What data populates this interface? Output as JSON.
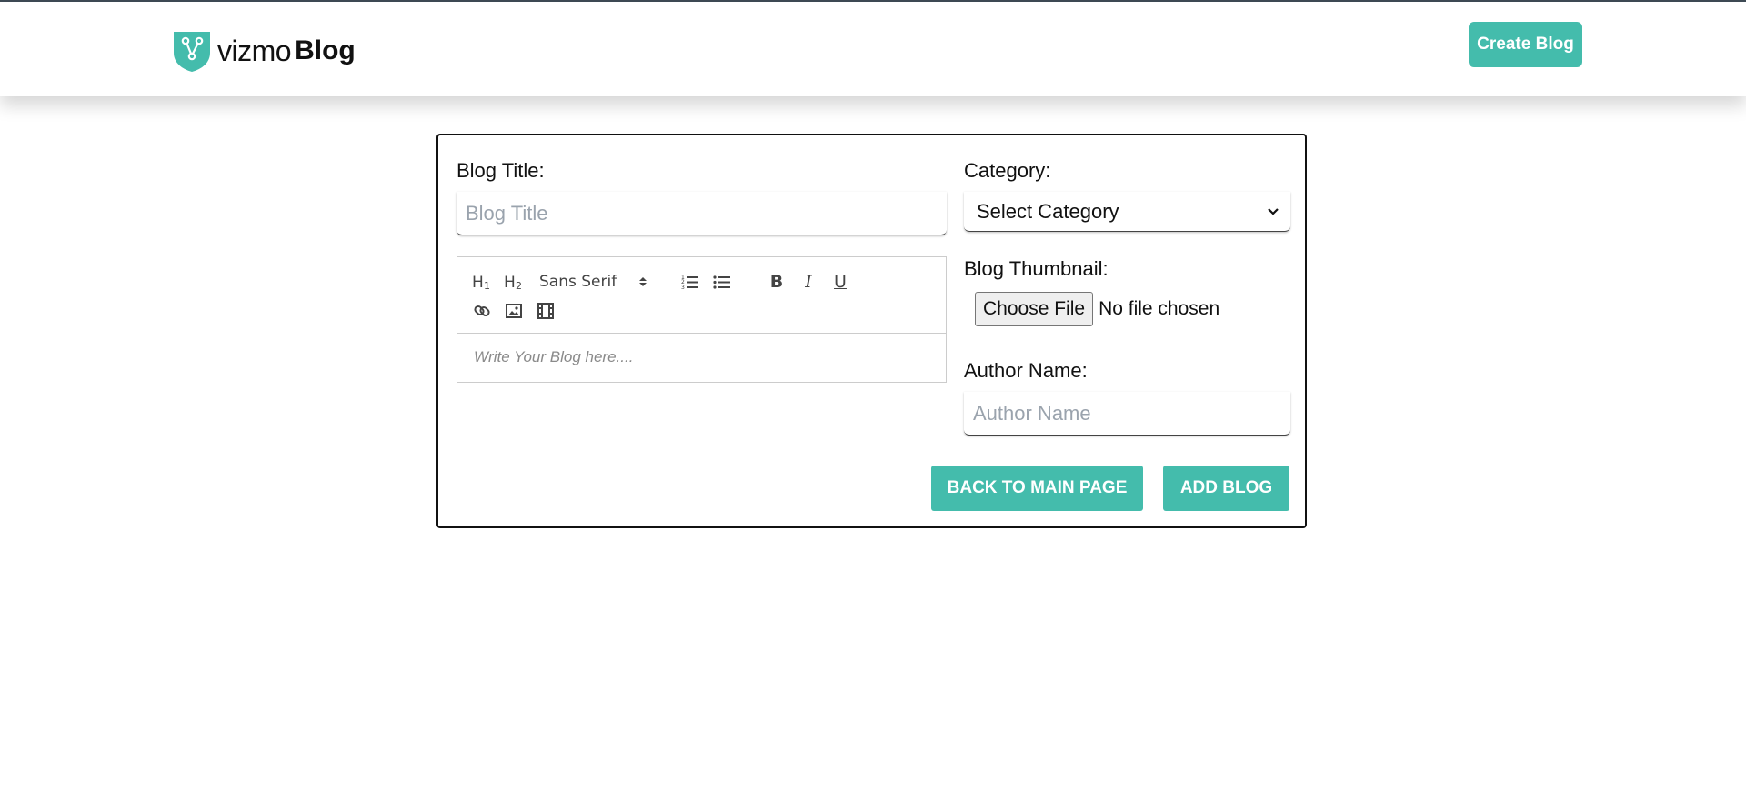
{
  "brand": {
    "name_part1": "vizmo",
    "name_part2": "Blog",
    "accent_color": "#44bcac",
    "logo_icon": "shield-share-icon"
  },
  "header": {
    "create_button_label": "Create Blog"
  },
  "form": {
    "title_label": "Blog Title:",
    "title_placeholder": "Blog Title",
    "category_label": "Category:",
    "category_selected": "Select Category",
    "thumbnail_label": "Blog Thumbnail:",
    "file_button_label": "Choose File",
    "file_status": "No file chosen",
    "author_label": "Author Name:",
    "author_placeholder": "Author Name",
    "back_button_label": "BACK TO MAIN PAGE",
    "add_button_label": "ADD BLOG"
  },
  "editor": {
    "font_selected": "Sans Serif",
    "placeholder": "Write Your Blog here....",
    "toolbar_icons": [
      "heading-1-icon",
      "heading-2-icon",
      "font-picker",
      "ordered-list-icon",
      "bullet-list-icon",
      "bold-icon",
      "italic-icon",
      "underline-icon",
      "link-icon",
      "image-icon",
      "video-icon"
    ]
  }
}
